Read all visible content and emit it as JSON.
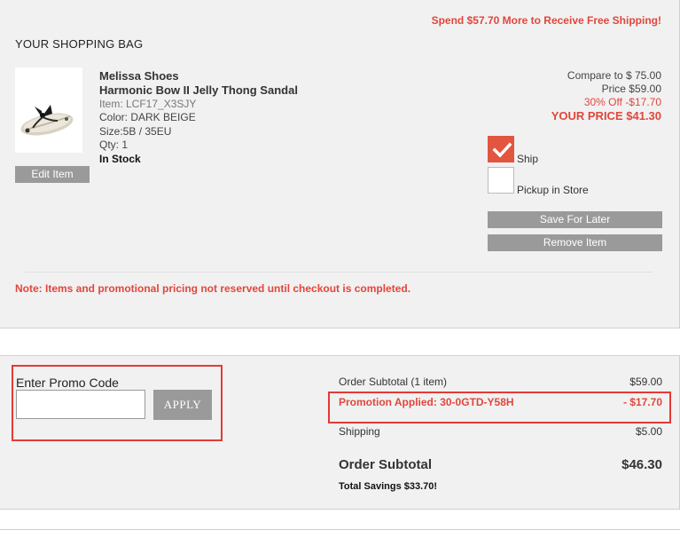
{
  "bag": {
    "shipping_promo": "Spend $57.70 More to Receive Free Shipping!",
    "title": "YOUR SHOPPING BAG",
    "note": "Note: Items and promotional pricing not reserved until checkout is completed."
  },
  "item": {
    "brand": "Melissa Shoes",
    "name": "Harmonic Bow II Jelly Thong Sandal",
    "item_no": "Item: LCF17_X3SJY",
    "color": "Color: DARK BEIGE",
    "size": "Size:5B / 35EU",
    "qty": "Qty: 1",
    "stock": "In Stock",
    "edit_label": "Edit Item",
    "image_icon": "sandal-product-image",
    "compare": "Compare to $ 75.00",
    "price": "Price $59.00",
    "discount": "30% Off -$17.70",
    "your_price": "YOUR PRICE $41.30",
    "ship_label": "Ship",
    "ship_checked": true,
    "pickup_label": "Pickup in Store",
    "pickup_checked": false,
    "save_label": "Save For Later",
    "remove_label": "Remove Item"
  },
  "promo": {
    "label": "Enter Promo Code",
    "input_value": "",
    "apply_label": "APPLY"
  },
  "summary": {
    "subtotal_label": "Order Subtotal (1 item)",
    "subtotal_value": "$59.00",
    "promo_label": "Promotion Applied: 30-0GTD-Y58H",
    "promo_value": "- $17.70",
    "shipping_label": "Shipping",
    "shipping_value": "$5.00",
    "order_label": "Order Subtotal",
    "order_value": "$46.30",
    "savings": "Total Savings $33.70!"
  },
  "colors": {
    "accent_red": "#e2463b",
    "button_grey": "#9a9a9a",
    "panel_bg": "#f1f1f1",
    "highlight_border": "#e53935"
  }
}
